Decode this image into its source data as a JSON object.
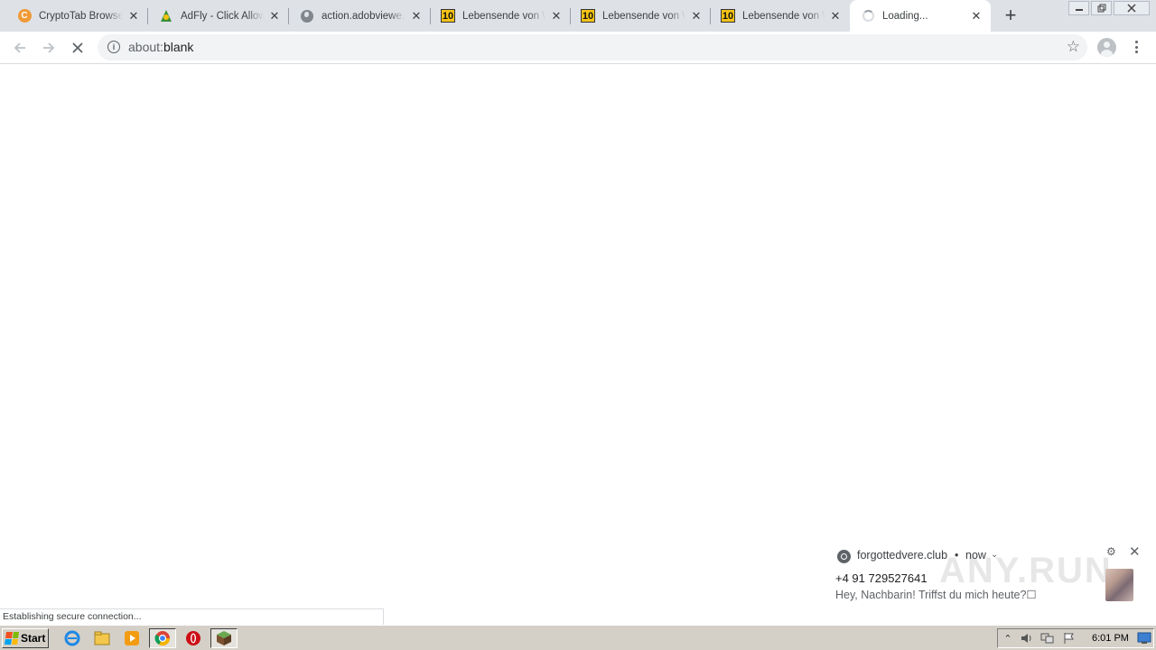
{
  "browser": {
    "tabs": [
      {
        "title": "CryptoTab Browser",
        "favicon": "cryptotab-icon",
        "active": false
      },
      {
        "title": "AdFly - Click Allow to",
        "favicon": "adfly-icon",
        "active": false
      },
      {
        "title": "action.adobviewe.club",
        "favicon": "globe-icon",
        "active": false
      },
      {
        "title": "Lebensende von W",
        "favicon": "ten-icon",
        "favicon_text": "10",
        "active": false
      },
      {
        "title": "Lebensende von W",
        "favicon": "ten-icon",
        "favicon_text": "10",
        "active": false
      },
      {
        "title": "Lebensende von W",
        "favicon": "ten-icon",
        "favicon_text": "10",
        "active": false
      },
      {
        "title": "Loading...",
        "favicon": "loading-spinner-icon",
        "active": true
      }
    ],
    "omnibox": {
      "scheme": "about:",
      "rest": "blank"
    },
    "status_text": "Establishing secure connection..."
  },
  "notification": {
    "origin": "forgottedvere.club",
    "separator": "•",
    "time": "now",
    "title": "+4 91 729527641",
    "body": "Hey, Nachbarin! Triffst du mich heute?☐"
  },
  "watermark": "ANY.RUN",
  "taskbar": {
    "start_label": "Start",
    "clock": "6:01 PM"
  },
  "colors": {
    "tab_strip": "#dee1e6",
    "omnibox": "#f1f3f4",
    "taskbar": "#d4d0c8"
  }
}
